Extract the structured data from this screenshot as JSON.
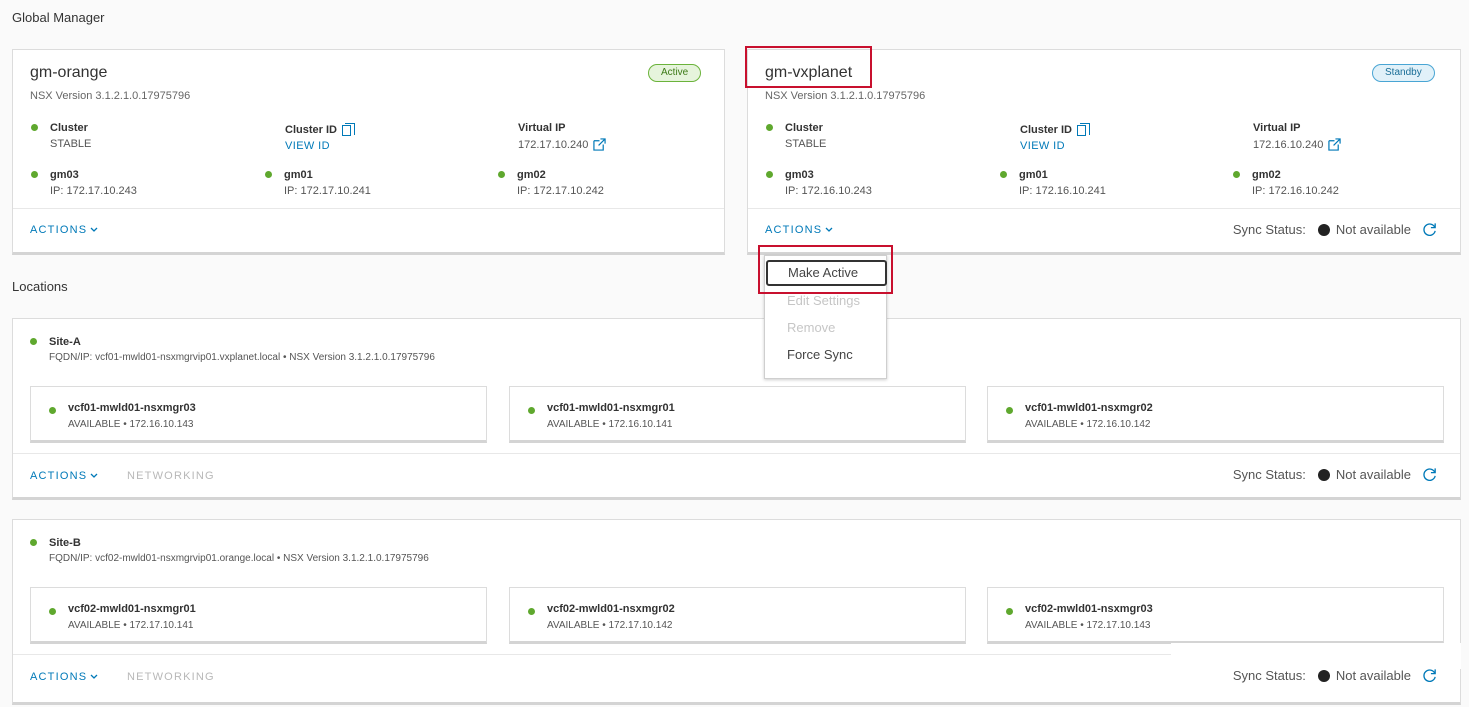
{
  "global_manager": {
    "section_title": "Global Manager",
    "managers": [
      {
        "name": "gm-orange",
        "status": "Active",
        "nsx_version": "NSX Version  3.1.2.1.0.17975796",
        "cluster_label": "Cluster",
        "cluster_value": "STABLE",
        "cluster_id_label": "Cluster ID",
        "cluster_id_link": "VIEW ID",
        "vip_label": "Virtual IP",
        "vip_value": "172.17.10.240",
        "nodes": [
          {
            "name": "gm03",
            "ip": "IP: 172.17.10.243"
          },
          {
            "name": "gm01",
            "ip": "IP: 172.17.10.241"
          },
          {
            "name": "gm02",
            "ip": "IP: 172.17.10.242"
          }
        ],
        "actions_label": "ACTIONS"
      },
      {
        "name": "gm-vxplanet",
        "status": "Standby",
        "nsx_version": "NSX Version  3.1.2.1.0.17975796",
        "cluster_label": "Cluster",
        "cluster_value": "STABLE",
        "cluster_id_label": "Cluster ID",
        "cluster_id_link": "VIEW ID",
        "vip_label": "Virtual IP",
        "vip_value": "172.16.10.240",
        "nodes": [
          {
            "name": "gm03",
            "ip": "IP: 172.16.10.243"
          },
          {
            "name": "gm01",
            "ip": "IP: 172.16.10.241"
          },
          {
            "name": "gm02",
            "ip": "IP: 172.16.10.242"
          }
        ],
        "actions_label": "ACTIONS",
        "sync_label": "Sync Status:",
        "sync_value": "Not available"
      }
    ]
  },
  "actions_menu": {
    "items": [
      "Make Active",
      "Edit Settings",
      "Remove",
      "Force Sync"
    ]
  },
  "locations": {
    "section_title": "Locations",
    "sites": [
      {
        "name": "Site-A",
        "fqdn": "FQDN/IP: vcf01-mwld01-nsxmgrvip01.vxplanet.local • NSX Version 3.1.2.1.0.17975796",
        "nodes": [
          {
            "name": "vcf01-mwld01-nsxmgr03",
            "status": "AVAILABLE • 172.16.10.143"
          },
          {
            "name": "vcf01-mwld01-nsxmgr01",
            "status": "AVAILABLE • 172.16.10.141"
          },
          {
            "name": "vcf01-mwld01-nsxmgr02",
            "status": "AVAILABLE • 172.16.10.142"
          }
        ],
        "actions_label": "ACTIONS",
        "networking_label": "NETWORKING",
        "sync_label": "Sync Status:",
        "sync_value": "Not available"
      },
      {
        "name": "Site-B",
        "fqdn": "FQDN/IP: vcf02-mwld01-nsxmgrvip01.orange.local • NSX Version 3.1.2.1.0.17975796",
        "nodes": [
          {
            "name": "vcf02-mwld01-nsxmgr01",
            "status": "AVAILABLE • 172.17.10.141"
          },
          {
            "name": "vcf02-mwld01-nsxmgr02",
            "status": "AVAILABLE • 172.17.10.142"
          },
          {
            "name": "vcf02-mwld01-nsxmgr03",
            "status": "AVAILABLE • 172.17.10.143"
          }
        ],
        "actions_label": "ACTIONS",
        "networking_label": "NETWORKING",
        "sync_label": "Sync Status:",
        "sync_value": "Not available"
      }
    ]
  },
  "colors": {
    "link": "#0079b8",
    "status_green": "#5fa82e",
    "highlight_red": "#c8102e"
  }
}
